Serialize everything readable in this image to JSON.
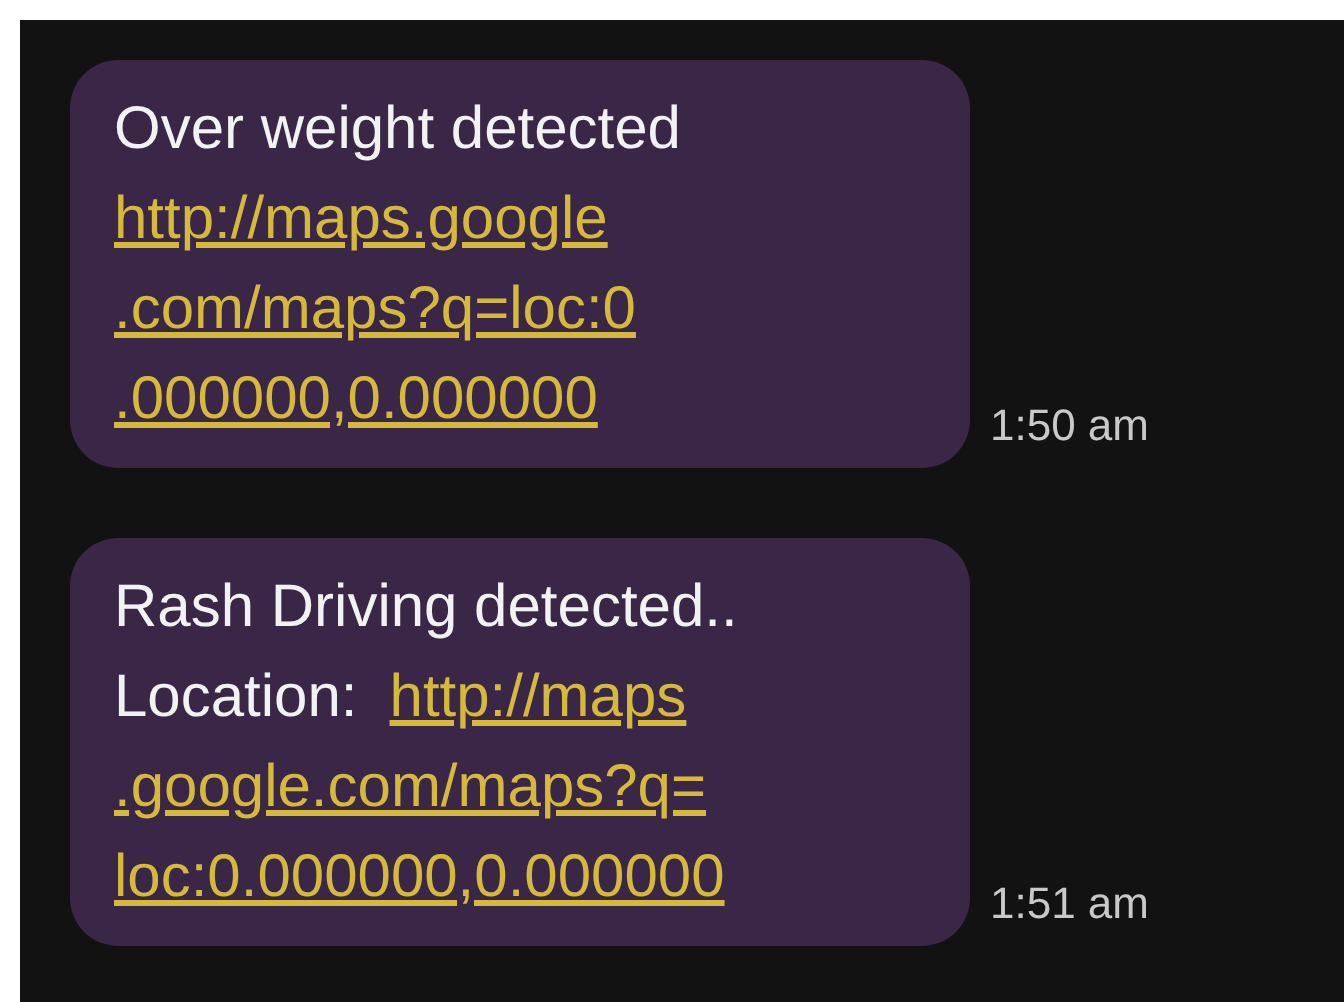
{
  "messages": [
    {
      "lines": [
        [
          {
            "kind": "text",
            "text": "Over weight detected"
          }
        ],
        [
          {
            "kind": "link",
            "text": "http://maps.google"
          }
        ],
        [
          {
            "kind": "link",
            "text": ".com/maps?q=loc:0"
          }
        ],
        [
          {
            "kind": "link",
            "text": ".000000,0.000000"
          }
        ]
      ],
      "time": "1:50 am"
    },
    {
      "lines": [
        [
          {
            "kind": "text",
            "text": "Rash Driving detected.."
          }
        ],
        [
          {
            "kind": "text",
            "text": "Location:"
          },
          {
            "kind": "link",
            "text": "http://maps"
          }
        ],
        [
          {
            "kind": "link",
            "text": ".google.com/maps?q="
          }
        ],
        [
          {
            "kind": "link",
            "text": "loc:0.000000,0.000000"
          }
        ]
      ],
      "time": "1:51 am"
    }
  ]
}
